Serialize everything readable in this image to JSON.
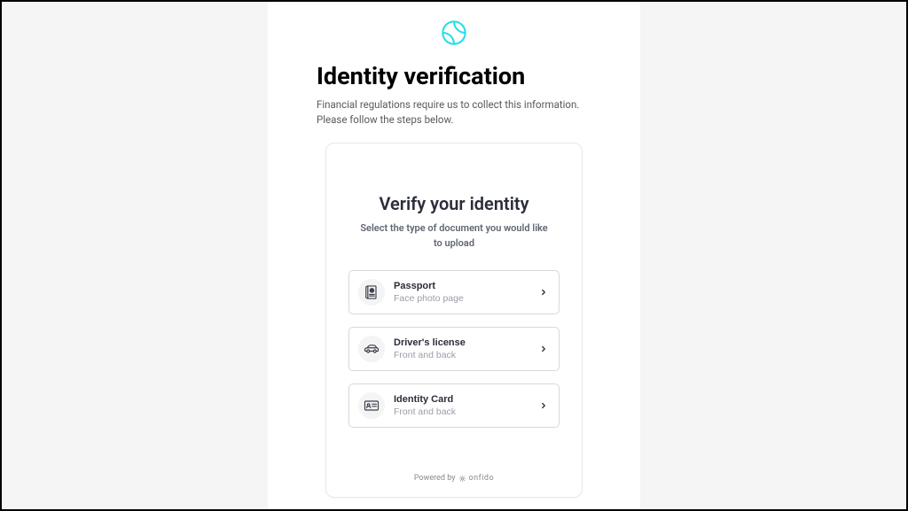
{
  "brand": {
    "logo_color": "#26ddec"
  },
  "header": {
    "title": "Identity verification",
    "subtitle_line1": "Financial regulations require us to collect this information.",
    "subtitle_line2": "Please follow the steps below."
  },
  "card": {
    "title": "Verify your identity",
    "subtitle": "Select the type of document you would like to upload",
    "options": [
      {
        "id": "passport",
        "title": "Passport",
        "desc": "Face photo page",
        "icon": "passport-icon"
      },
      {
        "id": "drivers-license",
        "title": "Driver's license",
        "desc": "Front and back",
        "icon": "car-icon"
      },
      {
        "id": "identity-card",
        "title": "Identity Card",
        "desc": "Front and back",
        "icon": "id-card-icon"
      }
    ],
    "powered_by_prefix": "Powered by",
    "powered_by_brand": "onfido"
  }
}
